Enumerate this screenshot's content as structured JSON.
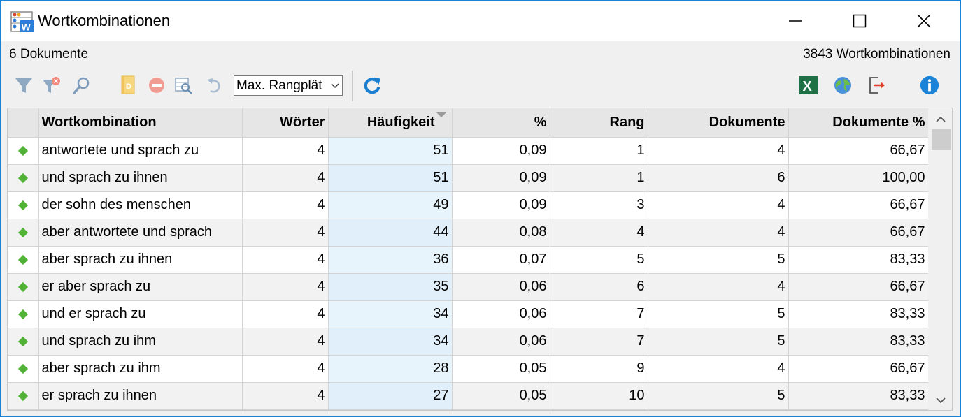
{
  "window": {
    "title": "Wortkombinationen",
    "icon": "wortkombinationen-app-icon"
  },
  "info": {
    "documents": "6 Dokumente",
    "combinations": "3843 Wortkombinationen"
  },
  "toolbar": {
    "icons": [
      "filter-icon",
      "filter-remove-icon",
      "search-icon",
      "document-icon",
      "remove-icon",
      "search-table-icon",
      "undo-icon",
      "refresh-icon",
      "excel-export-icon",
      "web-export-icon",
      "exit-icon",
      "info-icon"
    ],
    "rank_select": "Max. Rangplät"
  },
  "colors": {
    "accent": "#1883d7",
    "marker": "#52b237",
    "sorted_column": "#e8f4fc",
    "excel": "#1e7145",
    "info": "#1a83d8",
    "refresh": "#1a7fd0"
  },
  "table": {
    "columns": [
      "Wortkombination",
      "Wörter",
      "Häufigkeit",
      "%",
      "Rang",
      "Dokumente",
      "Dokumente %"
    ],
    "sorted_column": "Häufigkeit",
    "rows": [
      [
        "antwortete und sprach zu",
        "4",
        "51",
        "0,09",
        "1",
        "4",
        "66,67"
      ],
      [
        "und sprach zu ihnen",
        "4",
        "51",
        "0,09",
        "1",
        "6",
        "100,00"
      ],
      [
        "der sohn des menschen",
        "4",
        "49",
        "0,09",
        "3",
        "4",
        "66,67"
      ],
      [
        "aber antwortete und sprach",
        "4",
        "44",
        "0,08",
        "4",
        "4",
        "66,67"
      ],
      [
        "aber sprach zu ihnen",
        "4",
        "36",
        "0,07",
        "5",
        "5",
        "83,33"
      ],
      [
        "er aber sprach zu",
        "4",
        "35",
        "0,06",
        "6",
        "4",
        "66,67"
      ],
      [
        "und er sprach zu",
        "4",
        "34",
        "0,06",
        "7",
        "5",
        "83,33"
      ],
      [
        "und sprach zu ihm",
        "4",
        "34",
        "0,06",
        "7",
        "5",
        "83,33"
      ],
      [
        "aber sprach zu ihm",
        "4",
        "28",
        "0,05",
        "9",
        "4",
        "66,67"
      ],
      [
        "er sprach zu ihnen",
        "4",
        "27",
        "0,05",
        "10",
        "5",
        "83,33"
      ]
    ]
  }
}
